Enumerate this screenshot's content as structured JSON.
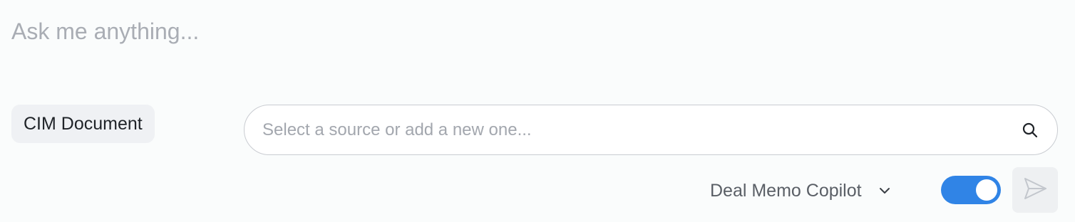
{
  "prompt": {
    "placeholder": "Ask me anything...",
    "value": ""
  },
  "attachment_chip": {
    "label": "CIM Document"
  },
  "source_search": {
    "placeholder": "Select a source or add a new one...",
    "value": "",
    "icon": "search-icon"
  },
  "model_selector": {
    "selected": "Deal Memo Copilot",
    "icon": "chevron-down-icon"
  },
  "toggle": {
    "state": "on",
    "accent_color": "#3084e6"
  },
  "send_button": {
    "icon": "send-icon",
    "state": "disabled"
  }
}
